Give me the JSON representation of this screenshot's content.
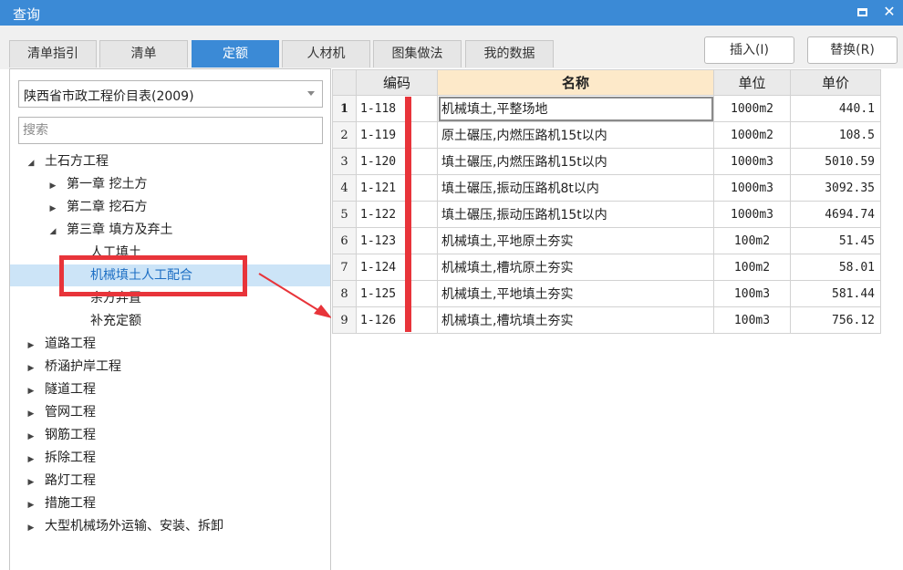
{
  "window": {
    "title": "查询",
    "maximize_icon": "maximize-icon",
    "close_icon": "close-icon",
    "close_glyph": "✕"
  },
  "tabs": [
    {
      "label": "清单指引",
      "active": false
    },
    {
      "label": "清单",
      "active": false
    },
    {
      "label": "定额",
      "active": true
    },
    {
      "label": "人材机",
      "active": false
    },
    {
      "label": "图集做法",
      "active": false
    },
    {
      "label": "我的数据",
      "active": false
    }
  ],
  "actions": {
    "insert": "插入(I)",
    "replace": "替换(R)"
  },
  "left": {
    "dropdown_value": "陕西省市政工程价目表(2009)",
    "search_placeholder": "搜索",
    "tree": [
      {
        "label": "土石方工程",
        "toggle": "◢",
        "level": 0
      },
      {
        "label": "第一章 挖土方",
        "toggle": "▶",
        "level": 1
      },
      {
        "label": "第二章 挖石方",
        "toggle": "▶",
        "level": 1
      },
      {
        "label": "第三章 填方及弃土",
        "toggle": "◢",
        "level": 1
      },
      {
        "label": "人工填土",
        "toggle": "",
        "level": 2
      },
      {
        "label": "机械填土人工配合",
        "toggle": "",
        "level": 2,
        "selected": true
      },
      {
        "label": "余方弃置",
        "toggle": "",
        "level": 2
      },
      {
        "label": "补充定额",
        "toggle": "",
        "level": 2
      },
      {
        "label": "道路工程",
        "toggle": "▶",
        "level": 0
      },
      {
        "label": "桥涵护岸工程",
        "toggle": "▶",
        "level": 0
      },
      {
        "label": "隧道工程",
        "toggle": "▶",
        "level": 0
      },
      {
        "label": "管网工程",
        "toggle": "▶",
        "level": 0
      },
      {
        "label": "钢筋工程",
        "toggle": "▶",
        "level": 0
      },
      {
        "label": "拆除工程",
        "toggle": "▶",
        "level": 0
      },
      {
        "label": "路灯工程",
        "toggle": "▶",
        "level": 0
      },
      {
        "label": "措施工程",
        "toggle": "▶",
        "level": 0
      },
      {
        "label": "大型机械场外运输、安装、拆卸",
        "toggle": "▶",
        "level": 0
      }
    ]
  },
  "table": {
    "headers": {
      "code": "编码",
      "name": "名称",
      "unit": "单位",
      "price": "单价"
    },
    "rows": [
      {
        "n": "1",
        "code": "1-118",
        "name": "机械填土,平整场地",
        "unit": "1000m2",
        "price": "440.1"
      },
      {
        "n": "2",
        "code": "1-119",
        "name": "原土碾压,内燃压路机15t以内",
        "unit": "1000m2",
        "price": "108.5"
      },
      {
        "n": "3",
        "code": "1-120",
        "name": "填土碾压,内燃压路机15t以内",
        "unit": "1000m3",
        "price": "5010.59"
      },
      {
        "n": "4",
        "code": "1-121",
        "name": "填土碾压,振动压路机8t以内",
        "unit": "1000m3",
        "price": "3092.35"
      },
      {
        "n": "5",
        "code": "1-122",
        "name": "填土碾压,振动压路机15t以内",
        "unit": "1000m3",
        "price": "4694.74"
      },
      {
        "n": "6",
        "code": "1-123",
        "name": "机械填土,平地原土夯实",
        "unit": "100m2",
        "price": "51.45"
      },
      {
        "n": "7",
        "code": "1-124",
        "name": "机械填土,槽坑原土夯实",
        "unit": "100m2",
        "price": "58.01"
      },
      {
        "n": "8",
        "code": "1-125",
        "name": "机械填土,平地填土夯实",
        "unit": "100m3",
        "price": "581.44"
      },
      {
        "n": "9",
        "code": "1-126",
        "name": "机械填土,槽坑填土夯实",
        "unit": "100m3",
        "price": "756.12"
      }
    ]
  },
  "colors": {
    "accent": "#3b8ad6",
    "annotation_red": "#e8343a",
    "selected_row_bg": "#cce4f7"
  }
}
